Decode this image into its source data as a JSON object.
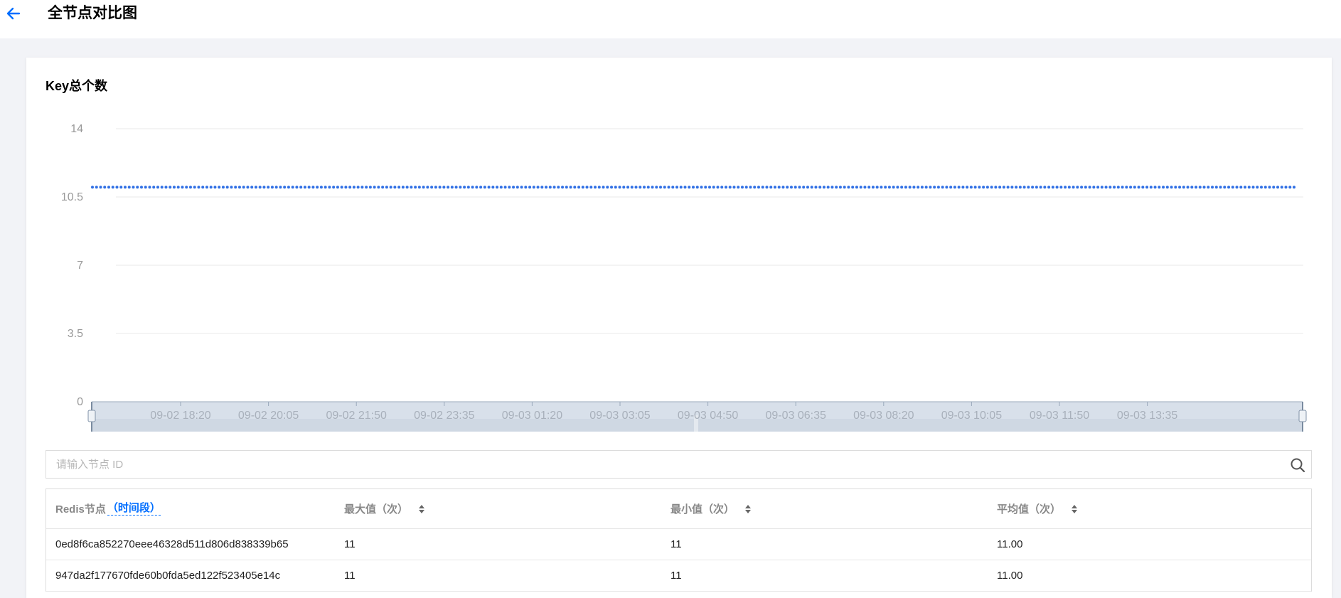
{
  "header": {
    "title": "全节点对比图",
    "back_icon": "arrow-left-icon"
  },
  "chart_section": {
    "title": "Key总个数"
  },
  "chart_data": {
    "type": "line",
    "title": "Key总个数",
    "ylim": [
      0,
      14
    ],
    "y_ticks": [
      "14",
      "10.5",
      "7",
      "3.5",
      "0"
    ],
    "y_tick_values": [
      14,
      10.5,
      7,
      3.5,
      0
    ],
    "x_ticks": [
      "09-02 18:20",
      "09-02 20:05",
      "09-02 21:50",
      "09-02 23:35",
      "09-03 01:20",
      "09-03 03:05",
      "09-03 04:50",
      "09-03 06:35",
      "09-03 08:20",
      "09-03 10:05",
      "09-03 11:50",
      "09-03 13:35"
    ],
    "series": [
      {
        "values": [
          11,
          11,
          11,
          11,
          11,
          11,
          11,
          11,
          11,
          11,
          11,
          11,
          11,
          11,
          11,
          11,
          11,
          11,
          11,
          11,
          11,
          11,
          11,
          11,
          11,
          11,
          11,
          11,
          11,
          11,
          11,
          11,
          11,
          11,
          11,
          11,
          11,
          11,
          11,
          11,
          11,
          11,
          11,
          11,
          11,
          11,
          11,
          11,
          11,
          11,
          11,
          11,
          11,
          11,
          11,
          11,
          11,
          11,
          11,
          11,
          11,
          11,
          11,
          11,
          11,
          11,
          11,
          11,
          11,
          11,
          11,
          11,
          11,
          11,
          11,
          11,
          11,
          11,
          11,
          11,
          11,
          11,
          11,
          11,
          11,
          11,
          11,
          11,
          11,
          11,
          11,
          11,
          11,
          11,
          11,
          11,
          11,
          11,
          11,
          11,
          11,
          11,
          11,
          11,
          11,
          11,
          11,
          11,
          11,
          11,
          11,
          11,
          11,
          11,
          11,
          11,
          11,
          11,
          11,
          11,
          11,
          11,
          11,
          11,
          11,
          11,
          11,
          11,
          11,
          11,
          11,
          11,
          11,
          11,
          11,
          11,
          11,
          11,
          11,
          11,
          11,
          11,
          11,
          11,
          11,
          11,
          11,
          11,
          11,
          11,
          11,
          11,
          11,
          11,
          11,
          11,
          11,
          11,
          11,
          11,
          11,
          11,
          11,
          11,
          11,
          11,
          11,
          11,
          11,
          11,
          11,
          11,
          11,
          11,
          11,
          11,
          11,
          11,
          11,
          11,
          11,
          11,
          11,
          11,
          11,
          11,
          11,
          11,
          11,
          11,
          11,
          11,
          11,
          11,
          11,
          11,
          11,
          11,
          11,
          11,
          11,
          11,
          11,
          11,
          11,
          11,
          11,
          11,
          11,
          11,
          11,
          11,
          11,
          11,
          11,
          11,
          11,
          11,
          11,
          11,
          11,
          11,
          11,
          11,
          11,
          11,
          11,
          11,
          11,
          11,
          11,
          11,
          11,
          11,
          11,
          11,
          11,
          11,
          11,
          11,
          11,
          11,
          11,
          11,
          11,
          11,
          11,
          11,
          11,
          11,
          11,
          11,
          11,
          11,
          11,
          11,
          11,
          11,
          11,
          11,
          11,
          11,
          11,
          11,
          11,
          11,
          11,
          11,
          11,
          11,
          11,
          11,
          11,
          11,
          11,
          11,
          11,
          11,
          11,
          11,
          11,
          11,
          11,
          11,
          11,
          11,
          11,
          11,
          11,
          11,
          11,
          11,
          11,
          11,
          11
        ],
        "color": "#2f6fe4"
      }
    ],
    "grid": true,
    "has_range_slider": true
  },
  "search": {
    "placeholder": "请输入节点 ID",
    "icon": "search-icon"
  },
  "table": {
    "columns": [
      {
        "label": "Redis节点",
        "extra": "（时间段）",
        "sortable": false
      },
      {
        "label": "最大值（次）",
        "sortable": true
      },
      {
        "label": "最小值（次）",
        "sortable": true
      },
      {
        "label": "平均值（次）",
        "sortable": true
      }
    ],
    "rows": [
      {
        "node": "0ed8f6ca852270eee46328d511d806d838339b65",
        "max": "11",
        "min": "11",
        "avg": "11.00"
      },
      {
        "node": "947da2f177670fde60b0fda5ed122f523405e14c",
        "max": "11",
        "min": "11",
        "avg": "11.00"
      }
    ]
  },
  "colors": {
    "accent": "#006eff",
    "line": "#2f6fe4",
    "slider_fill": "#cfd8e3"
  }
}
